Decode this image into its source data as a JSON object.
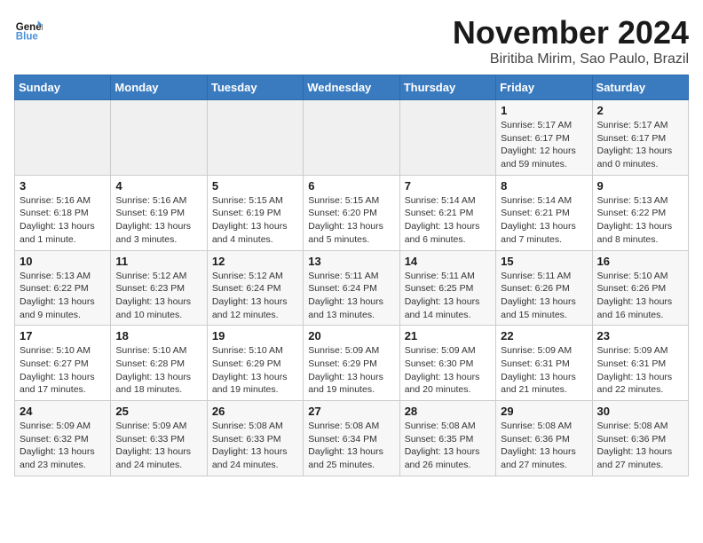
{
  "header": {
    "logo_line1": "General",
    "logo_line2": "Blue",
    "month_year": "November 2024",
    "location": "Biritiba Mirim, Sao Paulo, Brazil"
  },
  "weekdays": [
    "Sunday",
    "Monday",
    "Tuesday",
    "Wednesday",
    "Thursday",
    "Friday",
    "Saturday"
  ],
  "weeks": [
    [
      {
        "day": "",
        "info": ""
      },
      {
        "day": "",
        "info": ""
      },
      {
        "day": "",
        "info": ""
      },
      {
        "day": "",
        "info": ""
      },
      {
        "day": "",
        "info": ""
      },
      {
        "day": "1",
        "info": "Sunrise: 5:17 AM\nSunset: 6:17 PM\nDaylight: 12 hours and 59 minutes."
      },
      {
        "day": "2",
        "info": "Sunrise: 5:17 AM\nSunset: 6:17 PM\nDaylight: 13 hours and 0 minutes."
      }
    ],
    [
      {
        "day": "3",
        "info": "Sunrise: 5:16 AM\nSunset: 6:18 PM\nDaylight: 13 hours and 1 minute."
      },
      {
        "day": "4",
        "info": "Sunrise: 5:16 AM\nSunset: 6:19 PM\nDaylight: 13 hours and 3 minutes."
      },
      {
        "day": "5",
        "info": "Sunrise: 5:15 AM\nSunset: 6:19 PM\nDaylight: 13 hours and 4 minutes."
      },
      {
        "day": "6",
        "info": "Sunrise: 5:15 AM\nSunset: 6:20 PM\nDaylight: 13 hours and 5 minutes."
      },
      {
        "day": "7",
        "info": "Sunrise: 5:14 AM\nSunset: 6:21 PM\nDaylight: 13 hours and 6 minutes."
      },
      {
        "day": "8",
        "info": "Sunrise: 5:14 AM\nSunset: 6:21 PM\nDaylight: 13 hours and 7 minutes."
      },
      {
        "day": "9",
        "info": "Sunrise: 5:13 AM\nSunset: 6:22 PM\nDaylight: 13 hours and 8 minutes."
      }
    ],
    [
      {
        "day": "10",
        "info": "Sunrise: 5:13 AM\nSunset: 6:22 PM\nDaylight: 13 hours and 9 minutes."
      },
      {
        "day": "11",
        "info": "Sunrise: 5:12 AM\nSunset: 6:23 PM\nDaylight: 13 hours and 10 minutes."
      },
      {
        "day": "12",
        "info": "Sunrise: 5:12 AM\nSunset: 6:24 PM\nDaylight: 13 hours and 12 minutes."
      },
      {
        "day": "13",
        "info": "Sunrise: 5:11 AM\nSunset: 6:24 PM\nDaylight: 13 hours and 13 minutes."
      },
      {
        "day": "14",
        "info": "Sunrise: 5:11 AM\nSunset: 6:25 PM\nDaylight: 13 hours and 14 minutes."
      },
      {
        "day": "15",
        "info": "Sunrise: 5:11 AM\nSunset: 6:26 PM\nDaylight: 13 hours and 15 minutes."
      },
      {
        "day": "16",
        "info": "Sunrise: 5:10 AM\nSunset: 6:26 PM\nDaylight: 13 hours and 16 minutes."
      }
    ],
    [
      {
        "day": "17",
        "info": "Sunrise: 5:10 AM\nSunset: 6:27 PM\nDaylight: 13 hours and 17 minutes."
      },
      {
        "day": "18",
        "info": "Sunrise: 5:10 AM\nSunset: 6:28 PM\nDaylight: 13 hours and 18 minutes."
      },
      {
        "day": "19",
        "info": "Sunrise: 5:10 AM\nSunset: 6:29 PM\nDaylight: 13 hours and 19 minutes."
      },
      {
        "day": "20",
        "info": "Sunrise: 5:09 AM\nSunset: 6:29 PM\nDaylight: 13 hours and 19 minutes."
      },
      {
        "day": "21",
        "info": "Sunrise: 5:09 AM\nSunset: 6:30 PM\nDaylight: 13 hours and 20 minutes."
      },
      {
        "day": "22",
        "info": "Sunrise: 5:09 AM\nSunset: 6:31 PM\nDaylight: 13 hours and 21 minutes."
      },
      {
        "day": "23",
        "info": "Sunrise: 5:09 AM\nSunset: 6:31 PM\nDaylight: 13 hours and 22 minutes."
      }
    ],
    [
      {
        "day": "24",
        "info": "Sunrise: 5:09 AM\nSunset: 6:32 PM\nDaylight: 13 hours and 23 minutes."
      },
      {
        "day": "25",
        "info": "Sunrise: 5:09 AM\nSunset: 6:33 PM\nDaylight: 13 hours and 24 minutes."
      },
      {
        "day": "26",
        "info": "Sunrise: 5:08 AM\nSunset: 6:33 PM\nDaylight: 13 hours and 24 minutes."
      },
      {
        "day": "27",
        "info": "Sunrise: 5:08 AM\nSunset: 6:34 PM\nDaylight: 13 hours and 25 minutes."
      },
      {
        "day": "28",
        "info": "Sunrise: 5:08 AM\nSunset: 6:35 PM\nDaylight: 13 hours and 26 minutes."
      },
      {
        "day": "29",
        "info": "Sunrise: 5:08 AM\nSunset: 6:36 PM\nDaylight: 13 hours and 27 minutes."
      },
      {
        "day": "30",
        "info": "Sunrise: 5:08 AM\nSunset: 6:36 PM\nDaylight: 13 hours and 27 minutes."
      }
    ]
  ]
}
